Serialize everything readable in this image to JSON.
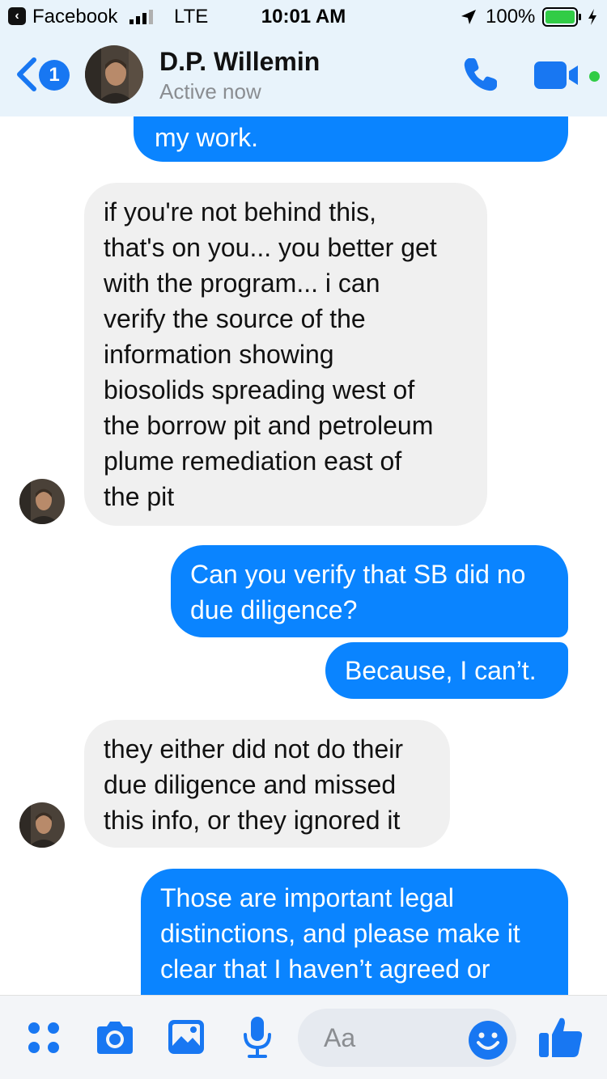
{
  "status_bar": {
    "back_app": "Facebook",
    "network": "LTE",
    "time": "10:01 AM",
    "battery": "100%"
  },
  "header": {
    "unread_count": "1",
    "contact_name": "D.P. Willemin",
    "contact_status": "Active now"
  },
  "messages": [
    {
      "direction": "outgoing",
      "lines": [
        "my work."
      ]
    },
    {
      "direction": "incoming",
      "lines": [
        "if you're not behind this,",
        "that's on you... you better get",
        "with the program... i can",
        "verify the source of the",
        "information showing",
        "biosolids spreading west of",
        "the borrow pit and petroleum",
        "plume remediation east of",
        "the pit"
      ]
    },
    {
      "direction": "outgoing",
      "lines": [
        "Can you verify that SB did no",
        "due diligence?"
      ]
    },
    {
      "direction": "outgoing",
      "lines": [
        "Because, I can’t."
      ]
    },
    {
      "direction": "incoming",
      "lines": [
        "they either did not do their",
        "due diligence and missed",
        "this info, or they ignored it"
      ]
    },
    {
      "direction": "outgoing",
      "lines": [
        "Those are important legal",
        "distinctions, and please make it",
        "clear that I haven’t agreed or"
      ]
    }
  ],
  "composer": {
    "placeholder": "Aa"
  },
  "colors": {
    "accent": "#0a84ff",
    "header_bg": "#e8f3fb",
    "incoming_bubble": "#f0f0f0",
    "active_dot": "#31cc46"
  },
  "icons": {
    "menu": "grid-menu-icon",
    "camera": "camera-icon",
    "gallery": "photo-gallery-icon",
    "mic": "microphone-icon",
    "emoji": "emoji-icon",
    "like": "thumbs-up-icon",
    "call": "phone-icon",
    "video": "video-camera-icon"
  }
}
